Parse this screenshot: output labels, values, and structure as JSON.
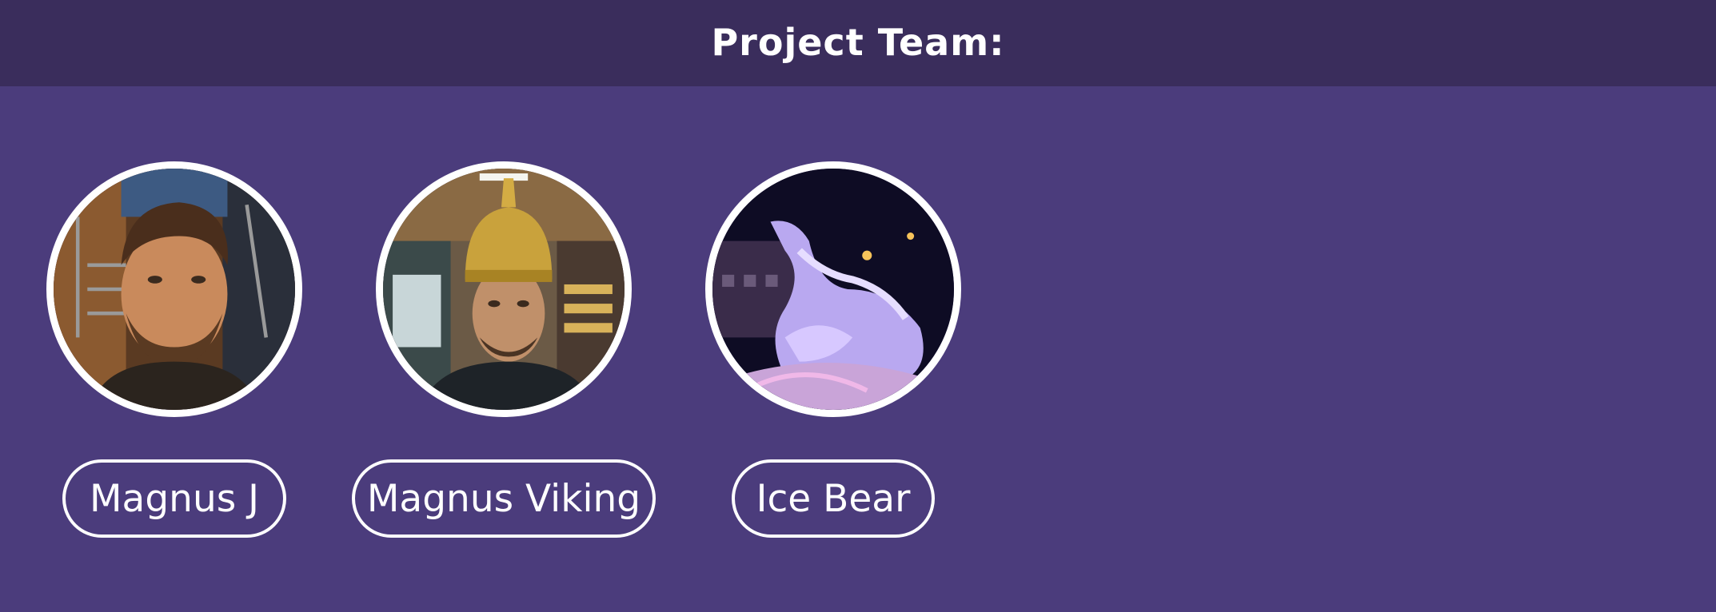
{
  "header": {
    "title": "Project Team:"
  },
  "colors": {
    "background": "#4b3c7c",
    "header_background": "#3a2d5c",
    "outline": "#ffffff"
  },
  "team": [
    {
      "name": "Magnus J",
      "photo": "portrait photo of bearded man by staircase"
    },
    {
      "name": "Magnus Viking",
      "photo": "portrait photo of man wearing golden viking helmet in store"
    },
    {
      "name": "Ice Bear",
      "photo": "illuminated ice sculpture of a polar bear at night"
    }
  ]
}
